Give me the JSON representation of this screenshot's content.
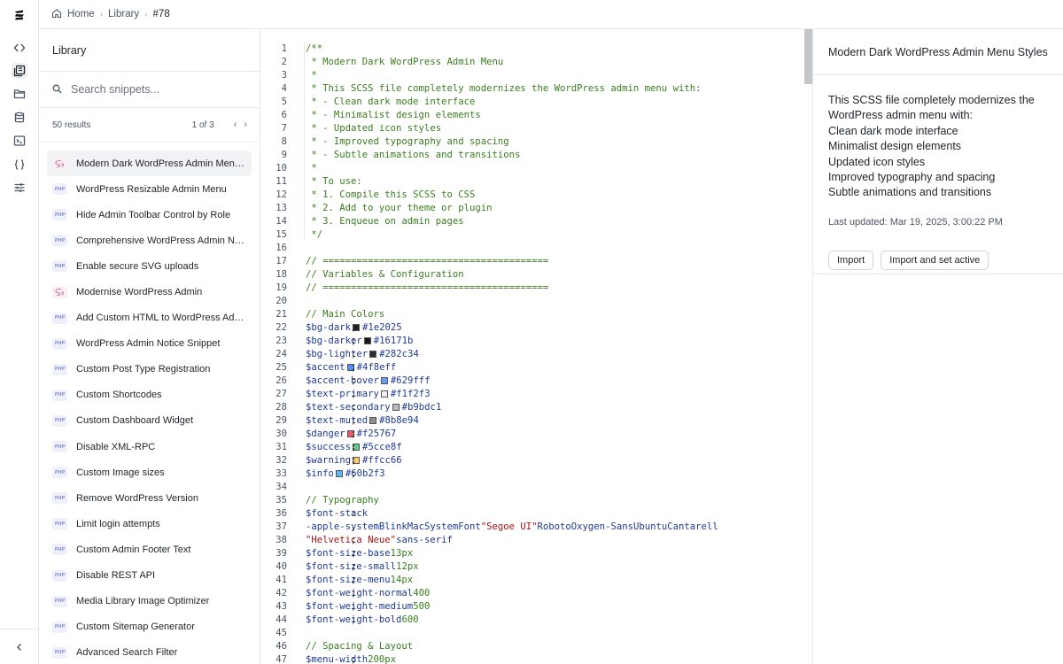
{
  "breadcrumb": {
    "home": "Home",
    "library": "Library",
    "current": "#78"
  },
  "library": {
    "title": "Library",
    "search_placeholder": "Search snippets...",
    "results_count": "50 results",
    "pagination": "1 of 3",
    "items": [
      {
        "label": "Modern Dark WordPress Admin Menu Styles",
        "type": "sass",
        "active": true
      },
      {
        "label": "WordPress Resizable Admin Menu",
        "type": "php"
      },
      {
        "label": "Hide Admin Toolbar Control by Role",
        "type": "php"
      },
      {
        "label": "Comprehensive WordPress Admin Notices",
        "type": "php"
      },
      {
        "label": "Enable secure SVG uploads",
        "type": "php"
      },
      {
        "label": "Modernise WordPress Admin",
        "type": "sass"
      },
      {
        "label": "Add Custom HTML to WordPress Admin",
        "type": "php"
      },
      {
        "label": "WordPress Admin Notice Snippet",
        "type": "php"
      },
      {
        "label": "Custom Post Type Registration",
        "type": "php"
      },
      {
        "label": "Custom Shortcodes",
        "type": "php"
      },
      {
        "label": "Custom Dashboard Widget",
        "type": "php"
      },
      {
        "label": "Disable XML-RPC",
        "type": "php"
      },
      {
        "label": "Custom Image sizes",
        "type": "php"
      },
      {
        "label": "Remove WordPress Version",
        "type": "php"
      },
      {
        "label": "Limit login attempts",
        "type": "php"
      },
      {
        "label": "Custom Admin Footer Text",
        "type": "php"
      },
      {
        "label": "Disable REST API",
        "type": "php"
      },
      {
        "label": "Media Library Image Optimizer",
        "type": "php"
      },
      {
        "label": "Custom Sitemap Generator",
        "type": "php"
      },
      {
        "label": "Advanced Search Filter",
        "type": "php"
      }
    ]
  },
  "badge_text": {
    "php": "PHP"
  },
  "code": {
    "lines": [
      [
        [
          "cm",
          "/**"
        ]
      ],
      [
        [
          "cm",
          " * Modern Dark WordPress Admin Menu"
        ]
      ],
      [
        [
          "cm",
          " *"
        ]
      ],
      [
        [
          "cm",
          " * This SCSS file completely modernizes the WordPress admin menu with:"
        ]
      ],
      [
        [
          "cm",
          " * - Clean dark mode interface"
        ]
      ],
      [
        [
          "cm",
          " * - Minimalist design elements"
        ]
      ],
      [
        [
          "cm",
          " * - Updated icon styles"
        ]
      ],
      [
        [
          "cm",
          " * - Improved typography and spacing"
        ]
      ],
      [
        [
          "cm",
          " * - Subtle animations and transitions"
        ]
      ],
      [
        [
          "cm",
          " *"
        ]
      ],
      [
        [
          "cm",
          " * To use:"
        ]
      ],
      [
        [
          "cm",
          " * 1. Compile this SCSS to CSS"
        ]
      ],
      [
        [
          "cm",
          " * 2. Add to your theme or plugin"
        ]
      ],
      [
        [
          "cm",
          " * 3. Enqueue on admin pages"
        ]
      ],
      [
        [
          "cm",
          " */"
        ]
      ],
      [],
      [
        [
          "cm",
          "// ========================================"
        ]
      ],
      [
        [
          "cm",
          "// Variables & Configuration"
        ]
      ],
      [
        [
          "cm",
          "// ========================================"
        ]
      ],
      [],
      [
        [
          "cm",
          "// Main Colors"
        ]
      ],
      [
        [
          "vr",
          "$bg-dark"
        ],
        [
          "tx",
          ": "
        ],
        [
          "sw",
          "#1e2025"
        ],
        [
          "vr",
          "#1e2025"
        ],
        [
          "tx",
          ";"
        ]
      ],
      [
        [
          "vr",
          "$bg-darker"
        ],
        [
          "tx",
          ": "
        ],
        [
          "sw",
          "#16171b"
        ],
        [
          "vr",
          "#16171b"
        ],
        [
          "tx",
          ";"
        ]
      ],
      [
        [
          "vr",
          "$bg-lighter"
        ],
        [
          "tx",
          ": "
        ],
        [
          "sw",
          "#282c34"
        ],
        [
          "vr",
          "#282c34"
        ],
        [
          "tx",
          ";"
        ]
      ],
      [
        [
          "vr",
          "$accent"
        ],
        [
          "tx",
          ": "
        ],
        [
          "sw",
          "#4f8eff"
        ],
        [
          "vr",
          "#4f8eff"
        ],
        [
          "tx",
          ";"
        ]
      ],
      [
        [
          "vr",
          "$accent-hover"
        ],
        [
          "tx",
          ": "
        ],
        [
          "sw",
          "#629fff"
        ],
        [
          "vr",
          "#629fff"
        ],
        [
          "tx",
          ";"
        ]
      ],
      [
        [
          "vr",
          "$text-primary"
        ],
        [
          "tx",
          ": "
        ],
        [
          "sw",
          "#f1f2f3"
        ],
        [
          "vr",
          "#f1f2f3"
        ],
        [
          "tx",
          ";"
        ]
      ],
      [
        [
          "vr",
          "$text-secondary"
        ],
        [
          "tx",
          ": "
        ],
        [
          "sw",
          "#b9bdc1"
        ],
        [
          "vr",
          "#b9bdc1"
        ],
        [
          "tx",
          ";"
        ]
      ],
      [
        [
          "vr",
          "$text-muted"
        ],
        [
          "tx",
          ": "
        ],
        [
          "sw",
          "#8b8e94"
        ],
        [
          "vr",
          "#8b8e94"
        ],
        [
          "tx",
          ";"
        ]
      ],
      [
        [
          "vr",
          "$danger"
        ],
        [
          "tx",
          ": "
        ],
        [
          "sw",
          "#f25767"
        ],
        [
          "vr",
          "#f25767"
        ],
        [
          "tx",
          ";"
        ]
      ],
      [
        [
          "vr",
          "$success"
        ],
        [
          "tx",
          ": "
        ],
        [
          "sw",
          "#5cce8f"
        ],
        [
          "vr",
          "#5cce8f"
        ],
        [
          "tx",
          ";"
        ]
      ],
      [
        [
          "vr",
          "$warning"
        ],
        [
          "tx",
          ": "
        ],
        [
          "sw",
          "#ffcc66"
        ],
        [
          "vr",
          "#ffcc66"
        ],
        [
          "tx",
          ";"
        ]
      ],
      [
        [
          "vr",
          "$info"
        ],
        [
          "tx",
          ": "
        ],
        [
          "sw",
          "#60b2f3"
        ],
        [
          "vr",
          "#60b2f3"
        ],
        [
          "tx",
          ";"
        ]
      ],
      [],
      [
        [
          "cm",
          "// Typography"
        ]
      ],
      [
        [
          "vr",
          "$font-stack"
        ],
        [
          "tx",
          ":"
        ]
      ],
      [
        [
          "tx",
          "  "
        ],
        [
          "kw",
          "-apple-system"
        ],
        [
          "tx",
          ", "
        ],
        [
          "kw",
          "BlinkMacSystemFont"
        ],
        [
          "tx",
          ", "
        ],
        [
          "st",
          "\"Segoe UI\""
        ],
        [
          "tx",
          ", "
        ],
        [
          "kw",
          "Roboto"
        ],
        [
          "tx",
          ", "
        ],
        [
          "kw",
          "Oxygen-Sans"
        ],
        [
          "tx",
          ", "
        ],
        [
          "kw",
          "Ubuntu"
        ],
        [
          "tx",
          ", "
        ],
        [
          "kw",
          "Cantarell"
        ],
        [
          "tx",
          ","
        ]
      ],
      [
        [
          "tx",
          "  "
        ],
        [
          "st",
          "\"Helvetica Neue\""
        ],
        [
          "tx",
          ", "
        ],
        [
          "kw",
          "sans-serif"
        ],
        [
          "tx",
          ";"
        ]
      ],
      [
        [
          "vr",
          "$font-size-base"
        ],
        [
          "tx",
          ": "
        ],
        [
          "nm",
          "13px"
        ],
        [
          "tx",
          ";"
        ]
      ],
      [
        [
          "vr",
          "$font-size-small"
        ],
        [
          "tx",
          ": "
        ],
        [
          "nm",
          "12px"
        ],
        [
          "tx",
          ";"
        ]
      ],
      [
        [
          "vr",
          "$font-size-menu"
        ],
        [
          "tx",
          ": "
        ],
        [
          "nm",
          "14px"
        ],
        [
          "tx",
          ";"
        ]
      ],
      [
        [
          "vr",
          "$font-weight-normal"
        ],
        [
          "tx",
          ": "
        ],
        [
          "nm",
          "400"
        ],
        [
          "tx",
          ";"
        ]
      ],
      [
        [
          "vr",
          "$font-weight-medium"
        ],
        [
          "tx",
          ": "
        ],
        [
          "nm",
          "500"
        ],
        [
          "tx",
          ";"
        ]
      ],
      [
        [
          "vr",
          "$font-weight-bold"
        ],
        [
          "tx",
          ": "
        ],
        [
          "nm",
          "600"
        ],
        [
          "tx",
          ";"
        ]
      ],
      [],
      [
        [
          "cm",
          "// Spacing & Layout"
        ]
      ],
      [
        [
          "vr",
          "$menu-width"
        ],
        [
          "tx",
          ": "
        ],
        [
          "nm",
          "200px"
        ],
        [
          "tx",
          ";"
        ]
      ]
    ]
  },
  "detail": {
    "title": "Modern Dark WordPress Admin Menu Styles",
    "description": [
      "This SCSS file completely modernizes the WordPress admin menu with:",
      "Clean dark mode interface",
      "Minimalist design elements",
      "Updated icon styles",
      "Improved typography and spacing",
      "Subtle animations and transitions"
    ],
    "last_updated": "Last updated: Mar 19, 2025, 3:00:22 PM",
    "import_label": "Import",
    "import_active_label": "Import and set active"
  }
}
